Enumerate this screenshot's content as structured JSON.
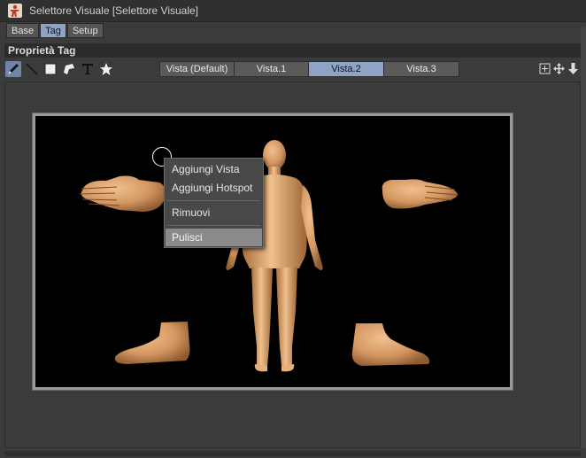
{
  "window": {
    "title": "Selettore Visuale [Selettore Visuale]"
  },
  "tabs": [
    {
      "label": "Base",
      "active": false
    },
    {
      "label": "Tag",
      "active": true
    },
    {
      "label": "Setup",
      "active": false
    }
  ],
  "section": {
    "title": "Proprietà Tag"
  },
  "tools": [
    "pen-icon",
    "line-icon",
    "square-icon",
    "polygon-icon",
    "text-icon",
    "star-icon"
  ],
  "vista_tabs": [
    {
      "label": "Vista (Default)",
      "active": false
    },
    {
      "label": "Vista.1",
      "active": false
    },
    {
      "label": "Vista.2",
      "active": true
    },
    {
      "label": "Vista.3",
      "active": false
    }
  ],
  "right_icons": [
    "add-frame-icon",
    "move-icon",
    "download-arrow-icon"
  ],
  "context_menu": {
    "items": [
      {
        "label": "Aggiungi Vista",
        "highlighted": false
      },
      {
        "label": "Aggiungi Hotspot",
        "highlighted": false
      },
      {
        "label": "Rimuovi",
        "highlighted": false
      },
      {
        "label": "Pulisci",
        "highlighted": true
      }
    ]
  },
  "colors": {
    "accent": "#8ea4c4",
    "skin": "#d9a070",
    "background": "#3b3b3b"
  }
}
